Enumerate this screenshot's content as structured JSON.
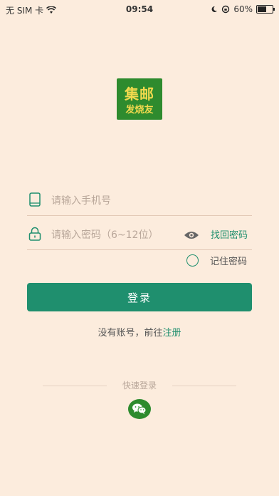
{
  "status_bar": {
    "carrier": "无 SIM 卡",
    "time": "09:54",
    "battery_percent": "60%",
    "battery_level": 0.6
  },
  "logo": {
    "line1": "集邮",
    "line2": "发烧友",
    "bg_color": "#2e8b2e",
    "text_color": "#f2d94e"
  },
  "form": {
    "phone_placeholder": "请输入手机号",
    "phone_value": "",
    "password_placeholder": "请输入密码（6~12位）",
    "password_value": "",
    "find_password": "找回密码",
    "remember_password": "记住密码",
    "login_button": "登录"
  },
  "register": {
    "prompt": "没有账号，前往",
    "link": "注册"
  },
  "quick_login": {
    "label": "快速登录",
    "icon": "wechat-icon"
  },
  "colors": {
    "accent": "#1f8f6e",
    "background": "#fcecdd"
  }
}
